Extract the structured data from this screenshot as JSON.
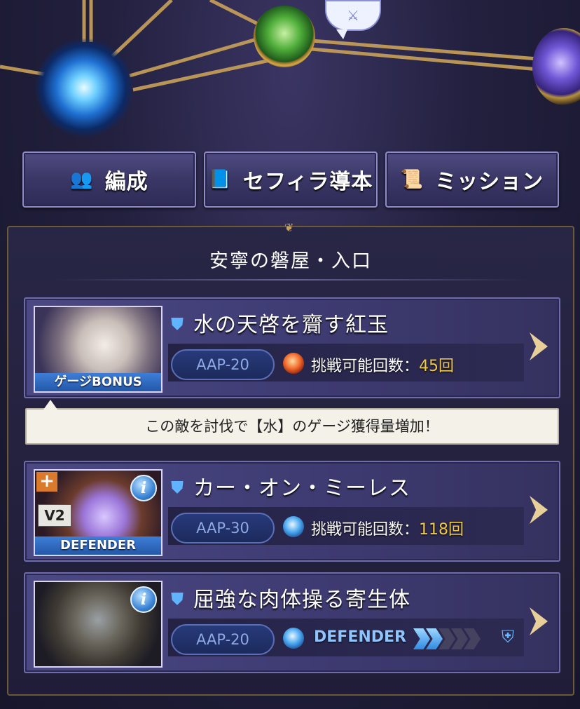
{
  "nav_buttons": {
    "formation": "編成",
    "sephira_guide": "セフィラ導本",
    "mission": "ミッション"
  },
  "area_title": "安寧の磐屋・入口",
  "quests": [
    {
      "name": "水の天啓を齎す紅玉",
      "thumb_label": "ゲージBONUS",
      "aap": "AAP-20",
      "element": "fire",
      "count_label": "挑戦可能回数：",
      "count_value": "45回"
    },
    {
      "name": "カー・オン・ミーレス",
      "thumb_label": "DEFENDER",
      "badge_plus": "+",
      "badge_version": "V2",
      "aap": "AAP-30",
      "element": "water",
      "count_label": "挑戦可能回数：",
      "count_value": "118回"
    },
    {
      "name": "屈強な肉体操る寄生体",
      "aap": "AAP-20",
      "element": "water",
      "defender_label": "DEFENDER",
      "defender_progress": "2/5"
    }
  ],
  "tooltip": "この敵を討伐で【水】のゲージ獲得量増加！",
  "colors": {
    "accent_gold": "#c9a159",
    "count_yellow": "#f0c94a",
    "defender_blue": "#2e8be3"
  }
}
